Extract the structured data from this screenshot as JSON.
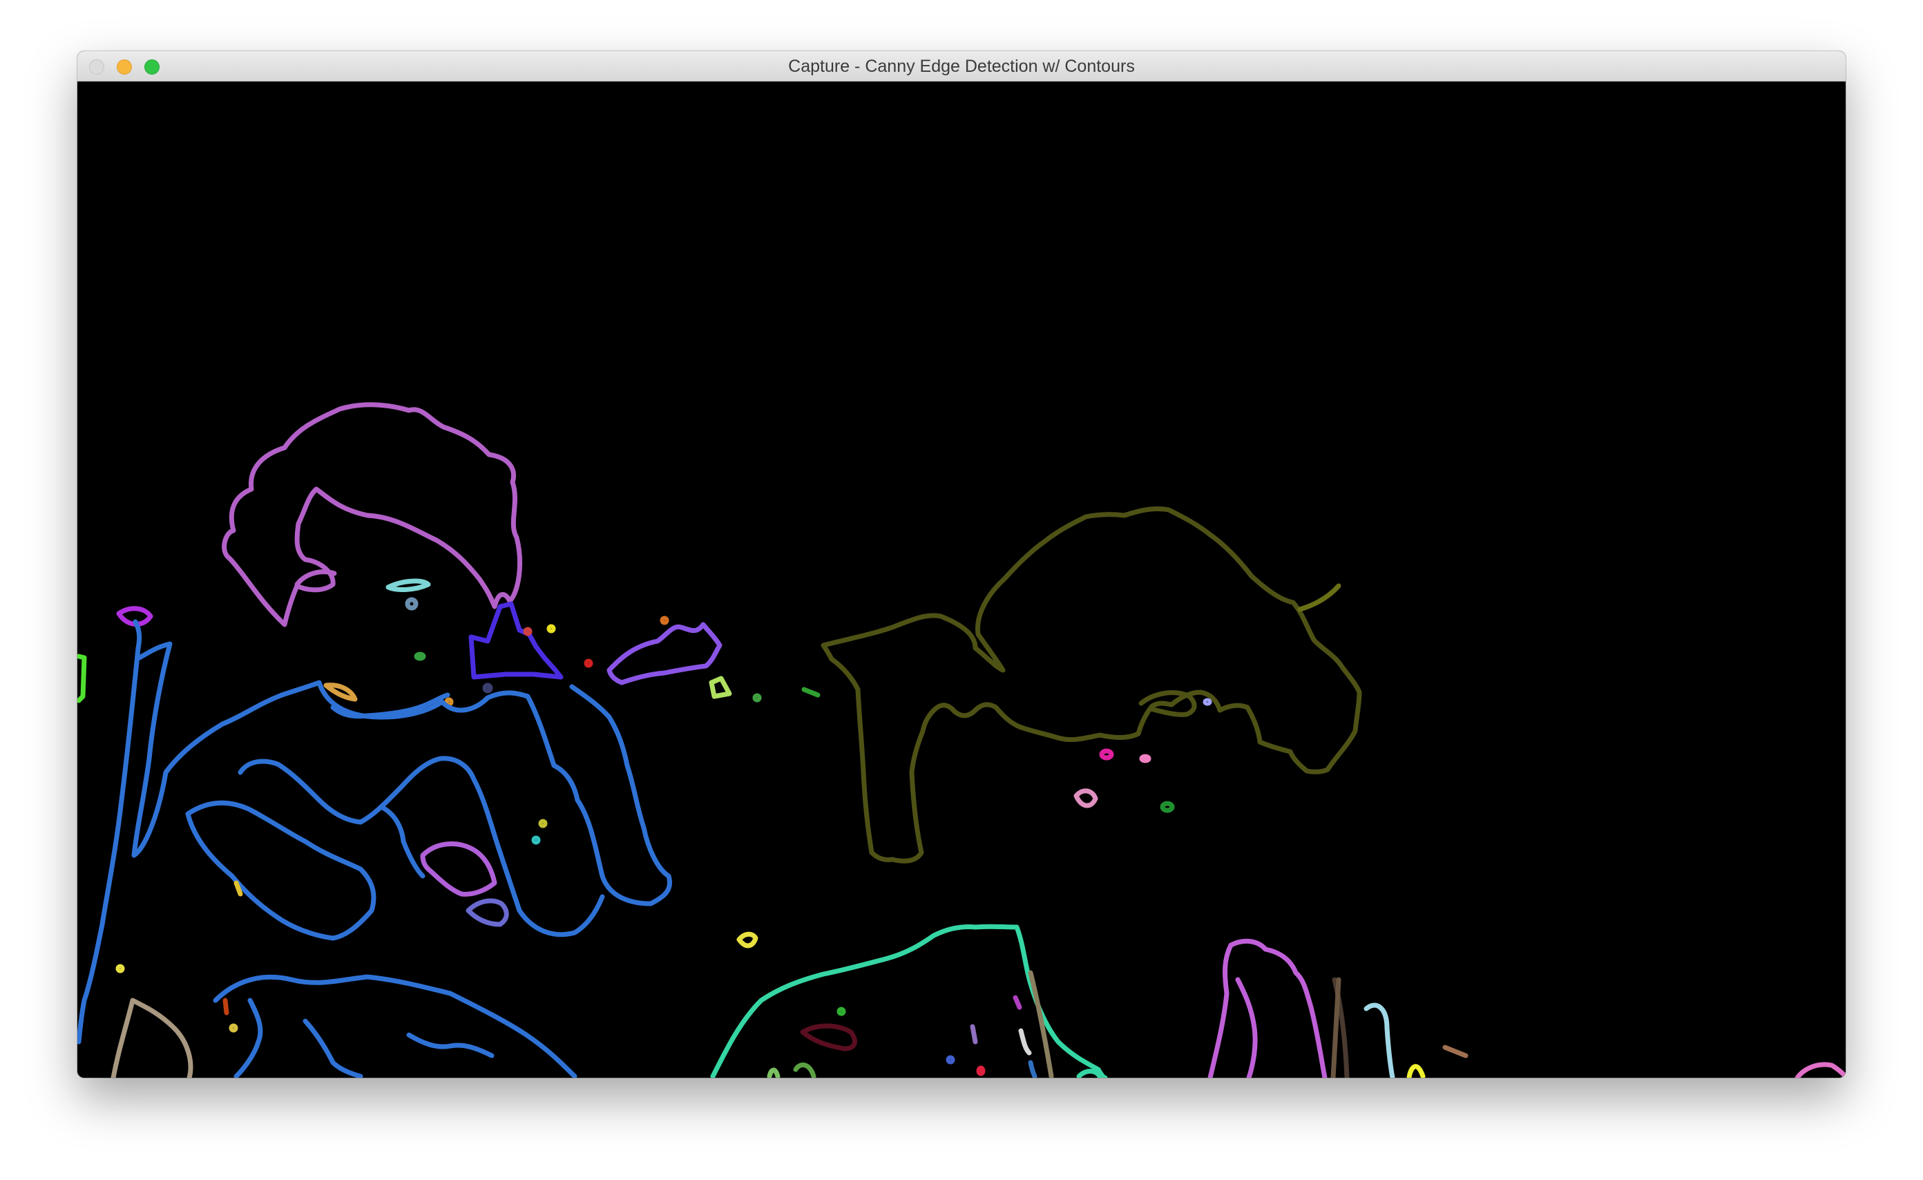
{
  "window": {
    "title": "Capture - Canny Edge Detection w/ Contours"
  },
  "titlebar_buttons": {
    "close": "close-button",
    "minimize": "minimize-button",
    "zoom": "zoom-button"
  },
  "colors": {
    "canvas_background": "#000000",
    "close": "#dcdcdc",
    "minimize": "#f7b73c",
    "zoom": "#31c546",
    "contour_hair": "#b361c8",
    "contour_body": "#2f72d6",
    "contour_olive": "#4e5215",
    "contour_teal": "#35d6a4",
    "contour_purple": "#8a55e6",
    "contour_indigo": "#4a2de0",
    "contour_pink": "#c060d8"
  }
}
